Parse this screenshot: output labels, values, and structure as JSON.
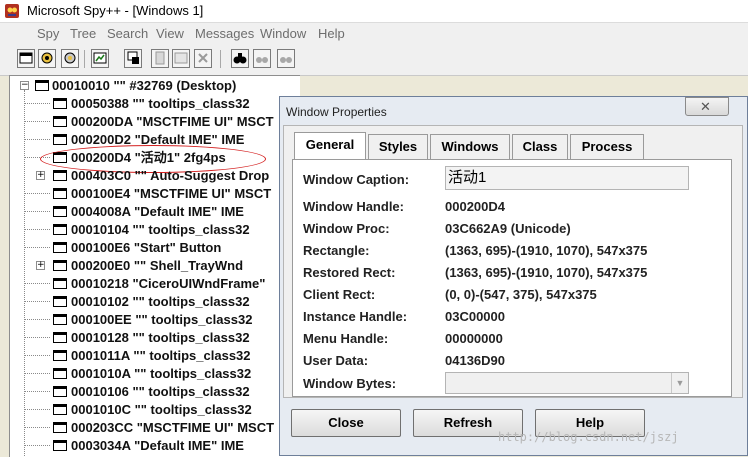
{
  "window": {
    "title": "Microsoft Spy++ - [Windows 1]"
  },
  "menu": [
    "Spy",
    "Tree",
    "Search",
    "View",
    "Messages",
    "Window",
    "Help"
  ],
  "toolbar": {
    "buttons": [
      "windows-icon",
      "processes-icon",
      "threads-icon",
      "messages-icon",
      "find-window-icon",
      "properties-icon",
      "log-icon",
      "clear-icon",
      "binoculars-icon",
      "find-next-icon",
      "find-prev-icon"
    ]
  },
  "tree": {
    "root": "00010010 \"\" #32769 (Desktop)",
    "items": [
      "00050388 \"\" tooltips_class32",
      "000200DA \"MSCTFIME UI\" MSCT",
      "000200D2 \"Default IME\" IME",
      "000200D4 \"活动1\" 2fg4ps",
      "000403C0 \"\" Auto-Suggest Drop",
      "000100E4 \"MSCTFIME UI\" MSCT",
      "0004008A \"Default IME\" IME",
      "00010104 \"\" tooltips_class32",
      "000100E6 \"Start\" Button",
      "000200E0 \"\" Shell_TrayWnd",
      "00010218 \"CiceroUIWndFrame\"",
      "00010102 \"\" tooltips_class32",
      "000100EE \"\" tooltips_class32",
      "00010128 \"\" tooltips_class32",
      "0001011A \"\" tooltips_class32",
      "0001010A \"\" tooltips_class32",
      "00010106 \"\" tooltips_class32",
      "0001010C \"\" tooltips_class32",
      "000203CC \"MSCTFIME UI\" MSCT",
      "0003034A \"Default IME\" IME"
    ]
  },
  "dialog": {
    "title": "Window Properties",
    "close_glyph": "✕",
    "tabs": [
      "General",
      "Styles",
      "Windows",
      "Class",
      "Process"
    ],
    "active_tab": "General",
    "fields": {
      "caption_label": "Window Caption:",
      "caption_value": "活动1",
      "handle_label": "Window Handle:",
      "handle_value": "000200D4",
      "proc_label": "Window Proc:",
      "proc_value": "03C662A9 (Unicode)",
      "rect_label": "Rectangle:",
      "rect_value": "(1363, 695)-(1910, 1070), 547x375",
      "restored_label": "Restored Rect:",
      "restored_value": "(1363, 695)-(1910, 1070), 547x375",
      "client_label": "Client Rect:",
      "client_value": "(0, 0)-(547, 375), 547x375",
      "instance_label": "Instance Handle:",
      "instance_value": "03C00000",
      "menu_label": "Menu Handle:",
      "menu_value": "00000000",
      "userdata_label": "User Data:",
      "userdata_value": "04136D90",
      "bytes_label": "Window Bytes:"
    },
    "buttons": {
      "close": "Close",
      "refresh": "Refresh",
      "help": "Help"
    }
  },
  "watermark": "http://blog.csdn.net/jszj"
}
